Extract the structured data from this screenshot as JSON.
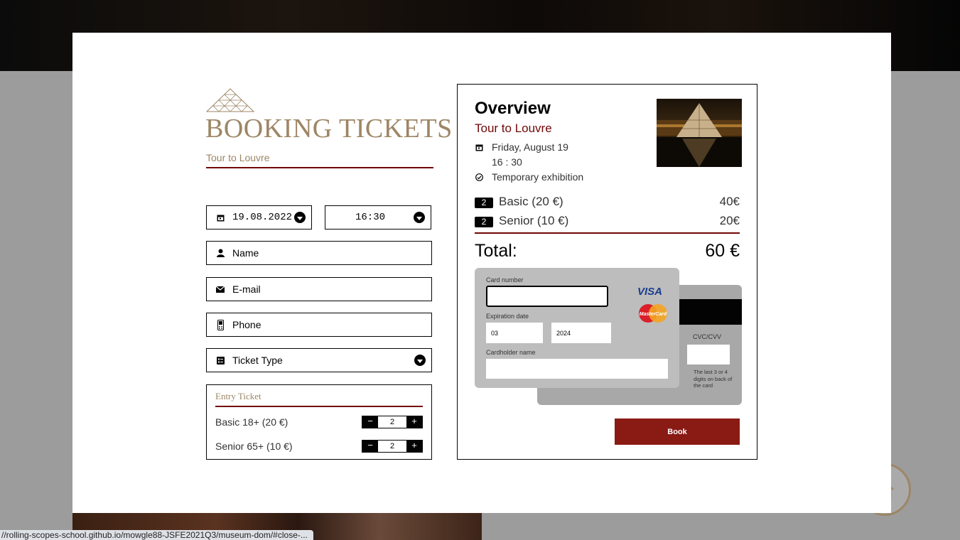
{
  "form": {
    "title": "BOOKING TICKETS",
    "tour": "Tour to Louvre",
    "date": "19.08.2022",
    "time": "16:30",
    "name_placeholder": "Name",
    "email_placeholder": "E-mail",
    "phone_placeholder": "Phone",
    "ticket_type_placeholder": "Ticket Type",
    "entry_title": "Entry Ticket",
    "tickets": [
      {
        "label": "Basic 18+ (20 €)",
        "qty": "2",
        "minus": "−",
        "plus": "+"
      },
      {
        "label": "Senior 65+ (10 €)",
        "qty": "2",
        "minus": "−",
        "plus": "+"
      }
    ]
  },
  "overview": {
    "title": "Overview",
    "tour": "Tour to Louvre",
    "date": "Friday, August 19",
    "time": "16 : 30",
    "exhibition": "Temporary exhibition",
    "lines": [
      {
        "count": "2",
        "label": "Basic (20 €)",
        "price": "40€"
      },
      {
        "count": "2",
        "label": "Senior (10 €)",
        "price": "20€"
      }
    ],
    "total_label": "Total:",
    "total_value": "60 €"
  },
  "card": {
    "number_label": "Card number",
    "number_value": "",
    "exp_label": "Expiration date",
    "exp_month": "03",
    "exp_year": "2024",
    "holder_label": "Cardholder name",
    "holder_value": "",
    "cvc_label": "CVC/CVV",
    "cvc_hint": "The last 3 or 4 digits on back of the card",
    "visa": "VISA",
    "mastercard": "MasterCard"
  },
  "book_button": "Book",
  "status_url": "//rolling-scopes-school.github.io/mowgle88-JSFE2021Q3/museum-dom/#close-...",
  "colors": {
    "accent": "#710707",
    "gold": "#9d8665",
    "book": "#8a1a14"
  }
}
